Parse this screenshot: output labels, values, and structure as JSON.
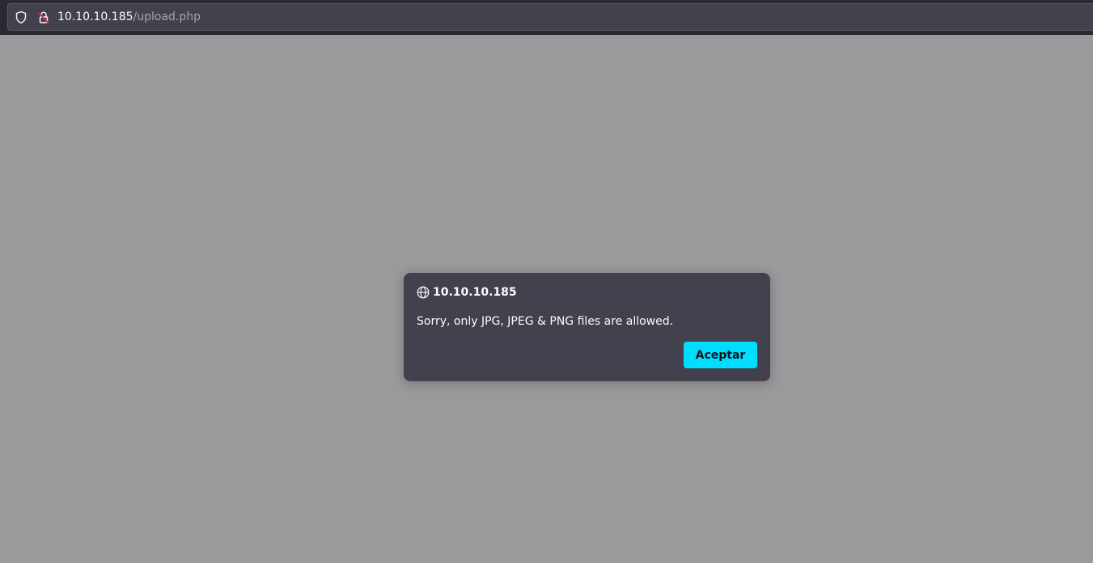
{
  "browser": {
    "url_host": "10.10.10.185",
    "url_path": "/upload.php",
    "icons": {
      "tracking_protection": "shield-icon",
      "connection": "insecure-lock-icon"
    }
  },
  "dialog": {
    "icon": "globe-icon",
    "title": "10.10.10.185",
    "message": "Sorry, only JPG, JPEG & PNG files are allowed.",
    "ok_label": "Aceptar"
  },
  "colors": {
    "toolbar": "#2b2a33",
    "urlbar": "#42414d",
    "page_overlay": "#9a9a9c",
    "dialog_bg": "#42414d",
    "accent_button": "#00ddff",
    "insecure_mark": "#e22850"
  }
}
